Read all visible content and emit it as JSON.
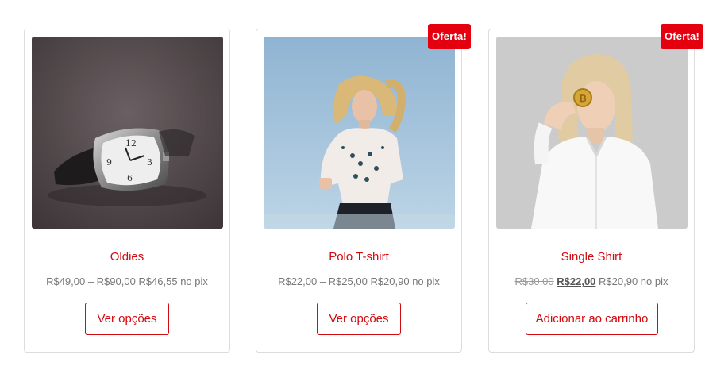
{
  "colors": {
    "accent": "#d10a10",
    "badge": "#e4000f"
  },
  "products": [
    {
      "name": "Oldies",
      "image_icon": "wristwatch-photo",
      "price_text": "R$49,00 – R$90,00 R$46,55 no pix",
      "button_label": "Ver opções"
    },
    {
      "name": "Polo T-shirt",
      "image_icon": "woman-embroidered-blouse-photo",
      "badge": "Oferta!",
      "price_text": "R$22,00 – R$25,00 R$20,90 no pix",
      "button_label": "Ver opções"
    },
    {
      "name": "Single Shirt",
      "image_icon": "woman-holding-coin-photo",
      "badge": "Oferta!",
      "old_price": "R$30,00",
      "new_price": "R$22,00",
      "pix_price": "R$20,90 no pix",
      "button_label": "Adicionar ao carrinho"
    }
  ]
}
